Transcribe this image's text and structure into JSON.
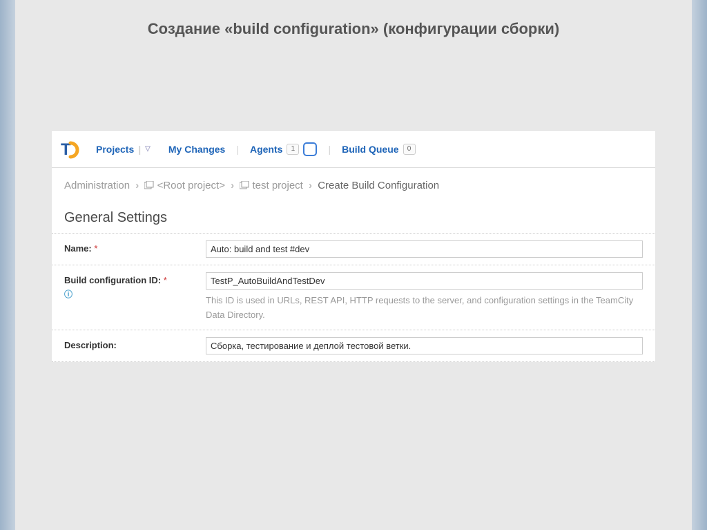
{
  "slide_title": "Создание «build configuration» (конфигурации сборки)",
  "nav": {
    "projects": "Projects",
    "my_changes": "My Changes",
    "agents": "Agents",
    "agents_count": "1",
    "build_queue": "Build Queue",
    "queue_count": "0"
  },
  "breadcrumb": {
    "admin": "Administration",
    "root": "<Root project>",
    "test": "test project",
    "current": "Create Build Configuration"
  },
  "section": "General Settings",
  "form": {
    "name_label": "Name:",
    "name_value": "Auto: build and test #dev",
    "id_label": "Build configuration ID:",
    "id_value": "TestP_AutoBuildAndTestDev",
    "id_hint": "This ID is used in URLs, REST API, HTTP requests to the server, and configuration settings in the TeamCity Data Directory.",
    "desc_label": "Description:",
    "desc_value": "Сборка, тестирование и деплой тестовой ветки."
  },
  "required_mark": "*"
}
